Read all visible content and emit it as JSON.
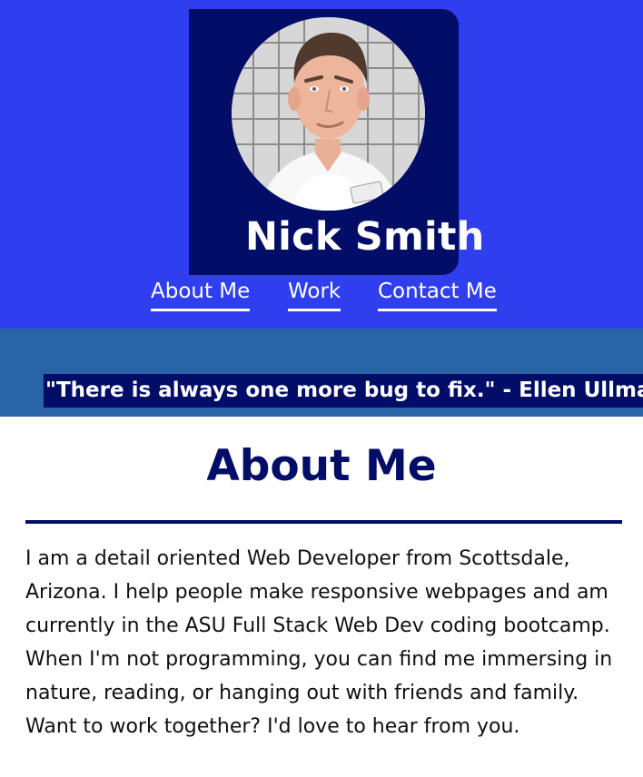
{
  "profile": {
    "name": "Nick Smith",
    "avatar_alt": "Nick Smith portrait"
  },
  "nav": {
    "items": [
      {
        "label": "About Me"
      },
      {
        "label": "Work"
      },
      {
        "label": "Contact Me"
      }
    ]
  },
  "quote": {
    "text": "\"There is always one more bug to fix.\" - Ellen Ullman"
  },
  "about": {
    "title": "About Me",
    "body": "I am a detail oriented Web Developer from Scottsdale, Arizona. I help people make responsive webpages and am currently in the ASU Full Stack Web Dev coding bootcamp. When I'm not programming, you can find me immersing in nature, reading, or hanging out with friends and family. Want to work together? I'd love to hear from you."
  },
  "colors": {
    "header_bg": "#2f3ff0",
    "navy": "#010d66",
    "quote_band": "#2a64a8",
    "text": "#101010"
  }
}
